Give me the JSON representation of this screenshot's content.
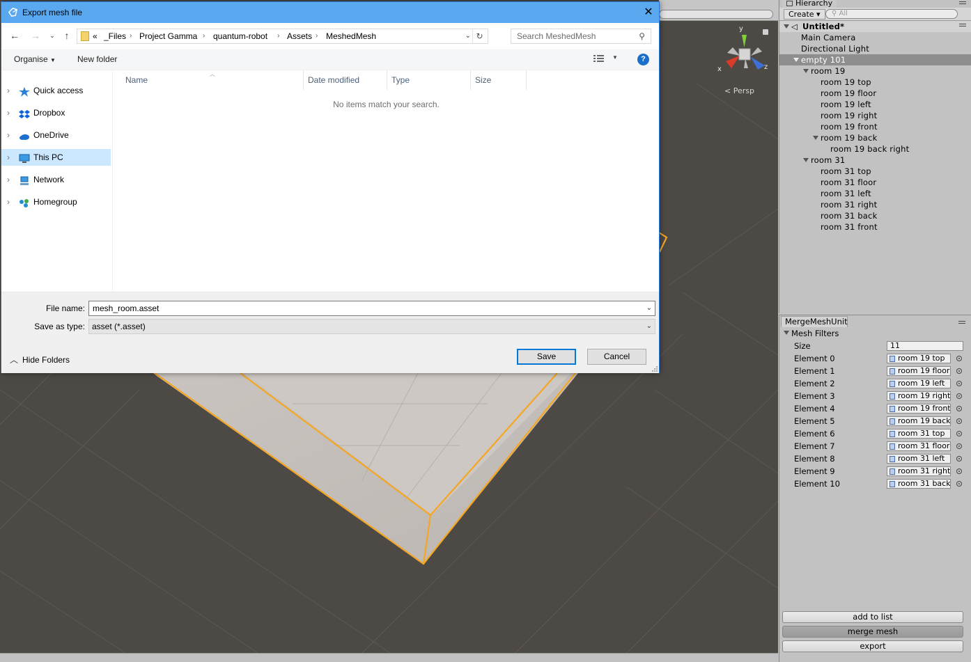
{
  "dialog": {
    "title": "Export mesh file",
    "breadcrumb": [
      "«",
      "_Files",
      "Project Gamma",
      "quantum-robot",
      "Assets",
      "MeshedMesh"
    ],
    "search_placeholder": "Search MeshedMesh",
    "organise_label": "Organise",
    "new_folder_label": "New folder",
    "help_label": "?",
    "nav_items": [
      {
        "label": "Quick access",
        "icon": "star-icon"
      },
      {
        "label": "Dropbox",
        "icon": "dropbox-icon"
      },
      {
        "label": "OneDrive",
        "icon": "cloud-icon"
      },
      {
        "label": "This PC",
        "icon": "computer-icon",
        "selected": true
      },
      {
        "label": "Network",
        "icon": "network-icon"
      },
      {
        "label": "Homegroup",
        "icon": "homegroup-icon"
      }
    ],
    "columns": [
      "Name",
      "Date modified",
      "Type",
      "Size"
    ],
    "empty_message": "No items match your search.",
    "file_name_label": "File name:",
    "file_name_value": "mesh_room.asset",
    "save_type_label": "Save as type:",
    "save_type_value": "asset (*.asset)",
    "save_label": "Save",
    "cancel_label": "Cancel",
    "hide_folders_label": "Hide Folders"
  },
  "scene": {
    "persp_label": "Persp",
    "axis_x": "x",
    "axis_y": "y",
    "axis_z": "z",
    "accent_color": "#f5a623"
  },
  "hierarchy": {
    "tab_label": "Hierarchy",
    "create_label": "Create",
    "search_placeholder": "All",
    "scene_name": "Untitled*",
    "items": [
      {
        "label": "Main Camera",
        "depth": 1
      },
      {
        "label": "Directional Light",
        "depth": 1
      },
      {
        "label": "empty 101",
        "depth": 1,
        "selected": true,
        "expanded": true
      },
      {
        "label": "room 19",
        "depth": 2,
        "expanded": true
      },
      {
        "label": "room 19 top",
        "depth": 3
      },
      {
        "label": "room 19 floor",
        "depth": 3
      },
      {
        "label": "room 19 left",
        "depth": 3
      },
      {
        "label": "room 19 right",
        "depth": 3
      },
      {
        "label": "room 19 front",
        "depth": 3
      },
      {
        "label": "room 19 back",
        "depth": 3,
        "expanded": true
      },
      {
        "label": "room 19 back right",
        "depth": 4
      },
      {
        "label": "room 31",
        "depth": 2,
        "expanded": true
      },
      {
        "label": "room 31 top",
        "depth": 3
      },
      {
        "label": "room 31 floor",
        "depth": 3
      },
      {
        "label": "room 31 left",
        "depth": 3
      },
      {
        "label": "room 31 right",
        "depth": 3
      },
      {
        "label": "room 31 back",
        "depth": 3
      },
      {
        "label": "room 31 front",
        "depth": 3
      }
    ]
  },
  "inspector": {
    "tab_label": "MergeMeshUnit",
    "section_label": "Mesh Filters",
    "size_label": "Size",
    "size_value": "11",
    "elements": [
      {
        "label": "Element 0",
        "value": "room 19 top"
      },
      {
        "label": "Element 1",
        "value": "room 19 floor"
      },
      {
        "label": "Element 2",
        "value": "room 19 left"
      },
      {
        "label": "Element 3",
        "value": "room 19 right"
      },
      {
        "label": "Element 4",
        "value": "room 19 front"
      },
      {
        "label": "Element 5",
        "value": "room 19 back"
      },
      {
        "label": "Element 6",
        "value": "room 31 top"
      },
      {
        "label": "Element 7",
        "value": "room 31 floor"
      },
      {
        "label": "Element 8",
        "value": "room 31 left"
      },
      {
        "label": "Element 9",
        "value": "room 31 right"
      },
      {
        "label": "Element 10",
        "value": "room 31 back"
      }
    ],
    "add_to_list_label": "add to list",
    "merge_mesh_label": "merge mesh",
    "export_label": "export"
  }
}
